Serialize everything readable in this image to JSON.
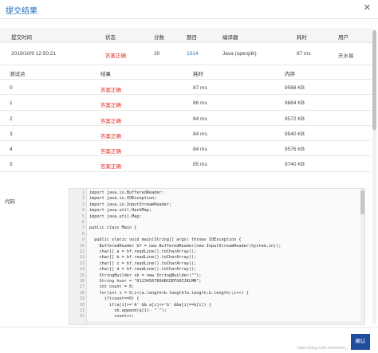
{
  "dialog": {
    "title": "提交结果",
    "close": "✕"
  },
  "summary": {
    "headers": [
      "提交时间",
      "状态",
      "分数",
      "题目",
      "编译器",
      "耗时",
      "用户"
    ],
    "row": [
      "2019/10/9 12:50:21",
      "答案正确",
      "20",
      "1014",
      "Java (openjdk)",
      "87 ms",
      "天水易"
    ]
  },
  "cases": {
    "headers": [
      "测试点",
      "结果",
      "耗时",
      "内存"
    ],
    "rows": [
      [
        "0",
        "答案正确",
        "87 ms",
        "9568 KB"
      ],
      [
        "1",
        "答案正确",
        "86 ms",
        "9684 KB"
      ],
      [
        "2",
        "答案正确",
        "84 ms",
        "9572 KB"
      ],
      [
        "3",
        "答案正确",
        "84 ms",
        "9540 KB"
      ],
      [
        "4",
        "答案正确",
        "84 ms",
        "9576 KB"
      ],
      [
        "5",
        "答案正确",
        "85 ms",
        "9740 KB"
      ]
    ]
  },
  "code": {
    "label": "代码",
    "lines": [
      "import java.io.BufferedReader;",
      "import java.io.IOException;",
      "import java.io.InputStreamReader;",
      "import java.util.HashMap;",
      "import java.util.Map;",
      "",
      "public class Main {",
      "",
      "  public static void main(String[] args) throws IOException {",
      "    BufferedReader bf = new BufferedReader(new InputStreamReader(System.in));",
      "    char[] a = bf.readLine().toCharArray();",
      "    char[] b = bf.readLine().toCharArray();",
      "    char[] c = bf.readLine().toCharArray();",
      "    char[] d = bf.readLine().toCharArray();",
      "    StringBuilder sb = new StringBuilder(\"\");",
      "    String hour = \"0123456789ABCDEFGHIJKLMN\";",
      "    int count = 0;",
      "    for(int i = 0;i<(a.length<b.length?a.length:b.length);i++) {",
      "      if(count==0) {",
      "        if(a[i]>='A' && a[i]<='G' &&a[i]==b[i]) {",
      "          sb.append(a[i]- \" \");",
      "          count++;"
    ]
  },
  "footer": {
    "confirm_label": "确认",
    "watermark": "https://blog.csdn.net/weixin_..."
  }
}
